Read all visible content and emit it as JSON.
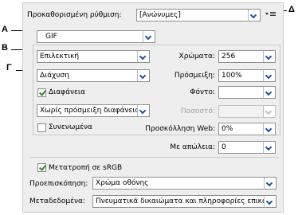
{
  "callouts": {
    "a": "Α",
    "b": "Β",
    "g": "Γ",
    "d": "Δ"
  },
  "preset": {
    "label": "Προκαθορισμένη ρύθμιση:",
    "value": "[Ανώνυμες]"
  },
  "format": {
    "value": "GIF"
  },
  "reduction": {
    "value": "Επιλεκτική"
  },
  "colors": {
    "label": "Χρώματα:",
    "value": "256"
  },
  "dither_algo": {
    "value": "Διάχυση"
  },
  "dither": {
    "label": "Πρόσμειξη:",
    "value": "100%"
  },
  "transparency": {
    "label": "Διαφάνεια",
    "checked": true
  },
  "matte": {
    "label": "Φόντο:",
    "value": ""
  },
  "transparency_dither": {
    "value": "Χωρίς πρόσμειξη διαφάνειας"
  },
  "amount": {
    "label": "Ποσοστό:",
    "value": ""
  },
  "interlaced": {
    "label": "Συνενωμένα",
    "checked": false
  },
  "web_snap": {
    "label": "Προσκόλληση Web:",
    "value": "0%"
  },
  "lossy": {
    "label": "Με απώλεια:",
    "value": "0"
  },
  "srgb": {
    "label": "Μετατροπή σε sRGB",
    "checked": true
  },
  "preview": {
    "label": "Προεπισκόπηση:",
    "value": "Χρώμα οθόνης"
  },
  "metadata": {
    "label": "Μεταδεδομένα:",
    "value": "Πνευματικά δικαιώματα και πληροφορίες επικοι"
  }
}
